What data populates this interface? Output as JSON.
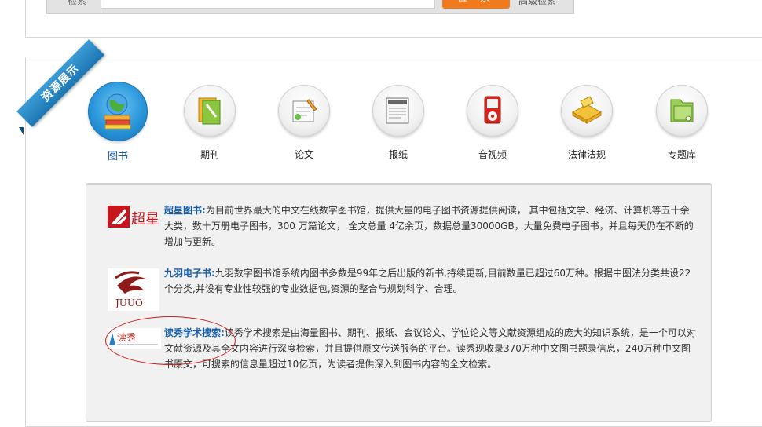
{
  "search": {
    "label": "检索",
    "button_label": "检 索",
    "advanced_label": "高级检索",
    "input_value": ""
  },
  "ribbon": {
    "text": "资源展示"
  },
  "categories": [
    {
      "label": "图书",
      "icon": "book-globe-icon",
      "active": true
    },
    {
      "label": "期刊",
      "icon": "journal-folder-icon",
      "active": false
    },
    {
      "label": "论文",
      "icon": "paper-pen-icon",
      "active": false
    },
    {
      "label": "报纸",
      "icon": "newspaper-icon",
      "active": false
    },
    {
      "label": "音视频",
      "icon": "media-player-icon",
      "active": false
    },
    {
      "label": "法律法规",
      "icon": "law-book-icon",
      "active": false
    },
    {
      "label": "专题库",
      "icon": "special-folder-icon",
      "active": false
    }
  ],
  "entries": [
    {
      "title": "超星图书:",
      "description": "为目前世界最大的中文在线数字图书馆，提供大量的电子图书资源提供阅读， 其中包括文学、经济、计算机等五十余大类，数十万册电子图书，300 万篇论文， 全文总量 4亿余页，数据总量30000GB，大量免费电子图书，并且每天仍在不断的增加与更新。",
      "logo_text": "超星"
    },
    {
      "title": "九羽电子书:",
      "description": "九羽数字图书馆系统内图书多数是99年之后出版的新书,持续更新,目前数量已超过60万种。根据中图法分类共设22个分类,并设有专业性较强的专业数据包,资源的整合与规划科学、合理。",
      "logo_text": "JUUO"
    },
    {
      "title": "读秀学术搜索:",
      "description": "读秀学术搜索是由海量图书、期刊、报纸、会议论文、学位论文等文献资源组成的庞大的知识系统，是一个可以对文献资源及其全文内容进行深度检索，并且提供原文传送服务的平台。读秀现收录370万种中文图书题录信息，240万种中文图书原文，可搜索的信息量超过10亿页，为读者提供深入到图书内容的全文检索。",
      "logo_text": "读秀"
    }
  ],
  "colors": {
    "accent": "#1a5fa5",
    "search_button": "#f07a1c",
    "ribbon": "#2a8ccc",
    "highlight": "#d01b1b"
  }
}
